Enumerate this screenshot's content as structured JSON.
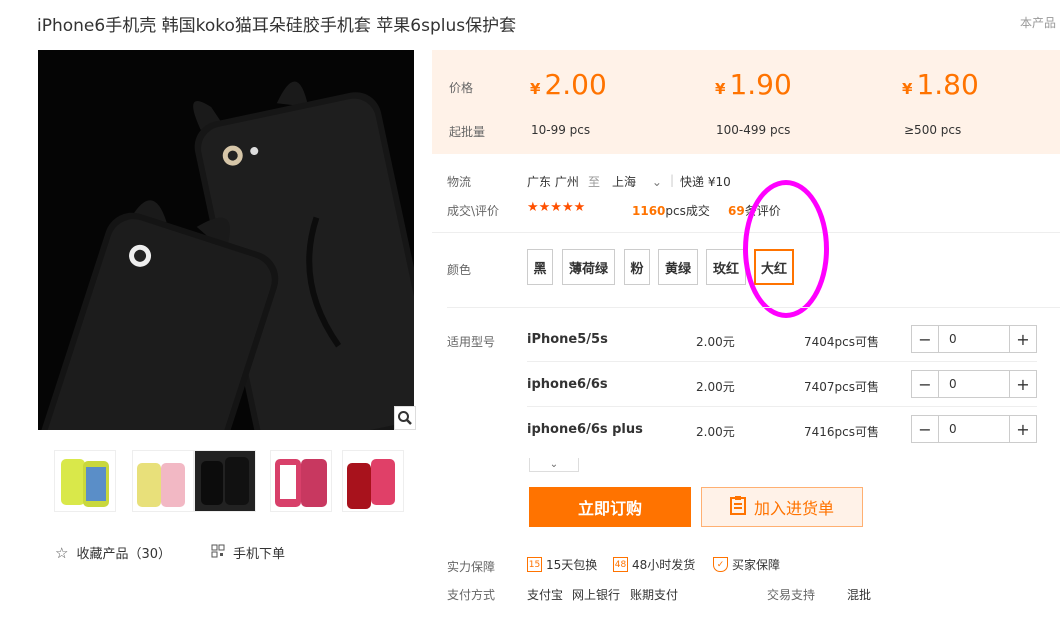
{
  "product": {
    "title": "iPhone6手机壳 韩国koko猫耳朵硅胶手机套 苹果6splus保护套",
    "corner_text": "本产品"
  },
  "gallery": {
    "thumbs": [
      "yellow-green case",
      "pink case",
      "black case",
      "rose red case",
      "red case"
    ],
    "favorite_label": "收藏产品（30）",
    "mobile_order_label": "手机下单"
  },
  "pricing": {
    "price_label": "价格",
    "moq_label": "起批量",
    "currency": "¥",
    "tiers": [
      {
        "price": "2.00",
        "range": "10-99 pcs"
      },
      {
        "price": "1.90",
        "range": "100-499 pcs"
      },
      {
        "price": "1.80",
        "range": "≥500 pcs"
      }
    ]
  },
  "logistics": {
    "label": "物流",
    "from": "广东 广州",
    "to_word": "至",
    "to": "上海",
    "shipping": "快递 ¥10"
  },
  "deals": {
    "label": "成交\\评价",
    "stars": "★★★★★",
    "sold_count": "1160",
    "sold_suffix": "pcs成交",
    "review_count": "69",
    "review_suffix": "条评价"
  },
  "colors": {
    "label": "颜色",
    "options": [
      "黑",
      "薄荷绿",
      "粉",
      "黄绿",
      "玫红",
      "大红"
    ],
    "selected": "大红"
  },
  "models": {
    "label": "适用型号",
    "rows": [
      {
        "name": "iPhone5/5s",
        "price": "2.00元",
        "stock": "7404",
        "stock_suffix": "pcs可售",
        "qty": "0"
      },
      {
        "name": "iphone6/6s",
        "price": "2.00元",
        "stock": "7407",
        "stock_suffix": "pcs可售",
        "qty": "0"
      },
      {
        "name": "iphone6/6s plus",
        "price": "2.00元",
        "stock": "7416",
        "stock_suffix": "pcs可售",
        "qty": "0"
      }
    ]
  },
  "buttons": {
    "buy_now": "立即订购",
    "add_to_list": "加入进货单"
  },
  "guarantee": {
    "label": "实力保障",
    "items": [
      "15天包换",
      "48小时发货",
      "买家保障"
    ]
  },
  "payment": {
    "label": "支付方式",
    "methods": [
      "支付宝",
      "网上银行",
      "账期支付"
    ],
    "trade_label": "交易支持",
    "trade_value": "混批"
  },
  "colors_theme": {
    "accent": "#ff7300",
    "price_bg": "#fff2e8",
    "annotation": "#ff00ff"
  }
}
